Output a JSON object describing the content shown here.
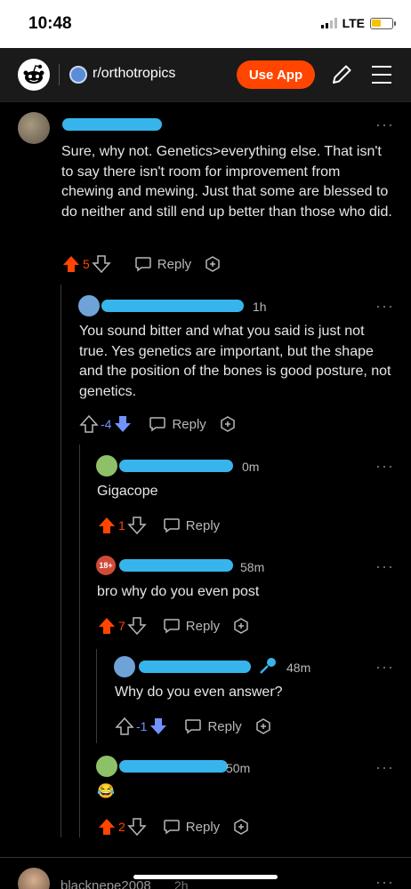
{
  "status": {
    "time": "10:48",
    "network": "LTE"
  },
  "header": {
    "subreddit": "r/orthotropics",
    "use_app": "Use App"
  },
  "comments": [
    {
      "time": "",
      "text": "Sure, why not. Genetics>everything else. That isn't to say there isn't room for improvement from chewing and mewing. Just that some are blessed to do neither and still end up better than those who did.",
      "score": "5",
      "reply": "Reply"
    },
    {
      "time": "1h",
      "text": "You sound bitter and what you said is just not true. Yes genetics are important, but the shape and the position of the bones is good posture, not genetics.",
      "score": "-4",
      "reply": "Reply"
    },
    {
      "time": "0m",
      "text": "Gigacope",
      "score": "1",
      "reply": "Reply"
    },
    {
      "time": "58m",
      "badge": "18+",
      "text": "bro why do you even post",
      "score": "7",
      "reply": "Reply"
    },
    {
      "time": "48m",
      "text": "Why do you even answer?",
      "score": "-1",
      "reply": "Reply"
    },
    {
      "time": "50m",
      "text": "😂",
      "score": "2",
      "reply": "Reply"
    }
  ],
  "next_comment": {
    "username": "blacknepe2008",
    "time": "2h"
  },
  "colors": {
    "upvote": "#ff4500",
    "downvote": "#7193ff",
    "accent": "#38b4ec"
  }
}
